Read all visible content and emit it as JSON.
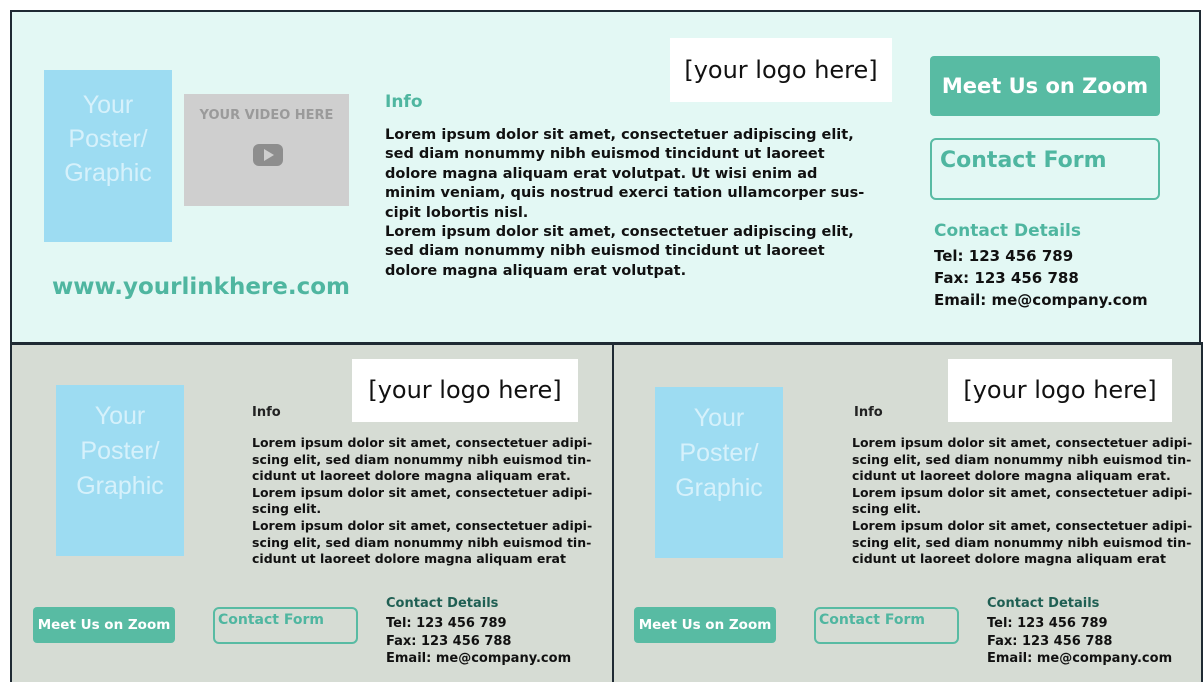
{
  "top": {
    "poster": [
      "Your",
      "Poster/",
      "Graphic"
    ],
    "video_label": "YOUR VIDEO HERE",
    "link": "www.yourlinkhere.com",
    "logo": "[your logo here]",
    "info_title": "Info",
    "info_lines": [
      "Lorem ipsum dolor sit amet, consectetuer adipiscing elit,",
      "sed diam nonummy nibh euismod tincidunt ut laoreet",
      "dolore magna aliquam erat volutpat. Ut wisi enim ad",
      "minim veniam, quis nostrud exerci tation ullamcorper sus-",
      "cipit lobortis nisl.",
      "Lorem ipsum dolor sit amet, consectetuer adipiscing elit,",
      "sed diam nonummy nibh euismod tincidunt ut laoreet",
      "dolore magna aliquam erat volutpat."
    ],
    "zoom_label": "Meet Us on Zoom",
    "contact_form_label": "Contact Form",
    "contact_title": "Contact Details",
    "tel": "Tel: 123 456 789",
    "fax": "Fax: 123 456 788",
    "email": "Email: me@company.com"
  },
  "small": {
    "poster": [
      "Your",
      "Poster/",
      "Graphic"
    ],
    "logo": "[your logo here]",
    "info_title": "Info",
    "info_lines": [
      "Lorem ipsum dolor sit amet, consectetuer adipi-",
      "scing elit, sed diam nonummy nibh euismod tin-",
      "cidunt ut laoreet dolore magna aliquam erat.",
      "Lorem ipsum dolor sit amet, consectetuer adipi-",
      "scing elit.",
      "Lorem ipsum dolor sit amet, consectetuer adipi-",
      "scing elit, sed diam nonummy nibh euismod tin-",
      "cidunt ut laoreet dolore magna aliquam erat"
    ],
    "zoom_label": "Meet Us on Zoom",
    "contact_form_label": "Contact Form",
    "contact_title": "Contact Details",
    "tel": "Tel: 123 456 789",
    "fax": "Fax: 123 456 788",
    "email": "Email: me@company.com"
  },
  "colors": {
    "top_background": "#e3f8f4",
    "bottom_background": "#d6dcd4",
    "accent": "#58bba3",
    "poster": "#9ddcf2"
  },
  "icons": {
    "video_play": "play-icon"
  }
}
